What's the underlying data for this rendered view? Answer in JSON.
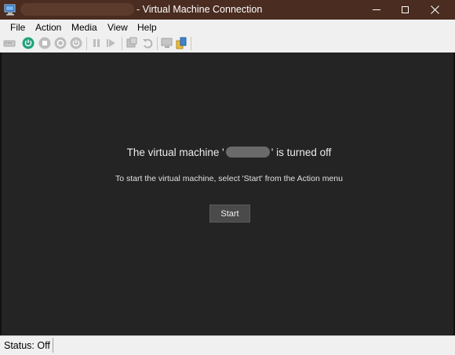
{
  "window": {
    "title": "- Virtual Machine Connection",
    "vm_name_redacted": true
  },
  "menubar": {
    "items": [
      "File",
      "Action",
      "Media",
      "View",
      "Help"
    ]
  },
  "toolbar": {
    "icons": [
      "ctrl-alt-del-icon",
      "start-icon",
      "turn-off-icon",
      "shut-down-icon",
      "save-icon",
      "pause-icon",
      "reset-icon",
      "checkpoint-icon",
      "revert-icon",
      "enhanced-session-icon",
      "share-icon"
    ]
  },
  "console": {
    "off_prefix": "The virtual machine '",
    "off_suffix": "' is turned off",
    "hint": "To start the virtual machine, select 'Start' from the Action menu",
    "start_label": "Start"
  },
  "status": {
    "text": "Status: Off"
  },
  "colors": {
    "titlebar": "#4a2c20",
    "console_bg": "#242424",
    "start_accent": "#1fa37a"
  }
}
